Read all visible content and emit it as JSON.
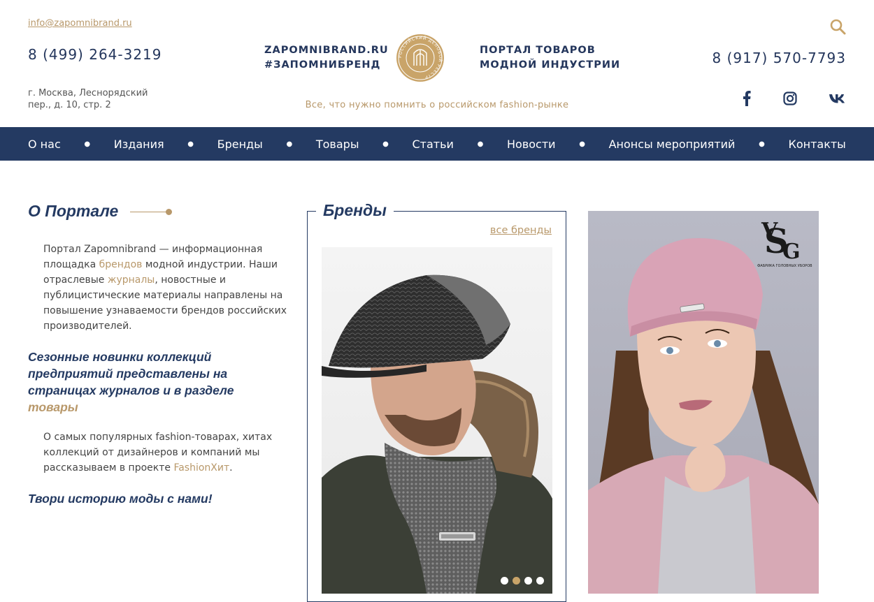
{
  "header": {
    "email": "info@zapomnibrand.ru",
    "phone_left": "8 (499) 264-3219",
    "phone_right": "8 (917) 570-7793",
    "address_line1": "г. Москва, Леснорядский",
    "address_line2": "пер., д. 10, стр. 2",
    "site_url": "ZAPOMNIBRAND.RU",
    "hashtag": "#ЗАПОМНИБРЕНД",
    "portal_line1": "ПОРТАЛ ТОВАРОВ",
    "portal_line2": "МОДНОЙ ИНДУСТРИИ",
    "seal_text": "РОССИЙСКИЙ ДЕЛОВОЙ РЕЕСТР",
    "tagline": "Все, что нужно помнить о российском fashion-рынке",
    "icons": [
      "search-icon",
      "facebook-icon",
      "instagram-icon",
      "vk-icon"
    ]
  },
  "nav": {
    "items": [
      "О нас",
      "Издания",
      "Бренды",
      "Товары",
      "Статьи",
      "Новости",
      "Анонсы мероприятий",
      "Контакты"
    ]
  },
  "about": {
    "title": "О Портале",
    "p1_a": "Портал Zapomnibrand — информационная площадка ",
    "p1_link1": "брендов",
    "p1_b": " модной индустрии. Наши отраслевые ",
    "p1_link2": "журналы",
    "p1_c": ", новостные и публицистические материалы направлены на повышение узнаваемости брендов российских производителей.",
    "h2_a": "Сезонные новинки коллекций предприятий представлены на страницах журналов и в разделе ",
    "h2_link": "товары",
    "p2_a": "О самых популярных fashion-товарах, хитах коллекций от дизайнеров и компаний мы рассказываем в проекте ",
    "p2_link": "FashionХит",
    "p2_b": ".",
    "closing": "Твори историю моды с нами!"
  },
  "brands": {
    "title": "Бренды",
    "all_link": "все бренды",
    "slider": {
      "total_slides": 4,
      "active_slide": 2
    }
  },
  "banner": {
    "logo_letters": "VSG",
    "logo_caption": "ФАБРИКА ГОЛОВНЫХ УБОРОВ"
  },
  "colors": {
    "navy": "#243a62",
    "gold": "#b8986a"
  }
}
